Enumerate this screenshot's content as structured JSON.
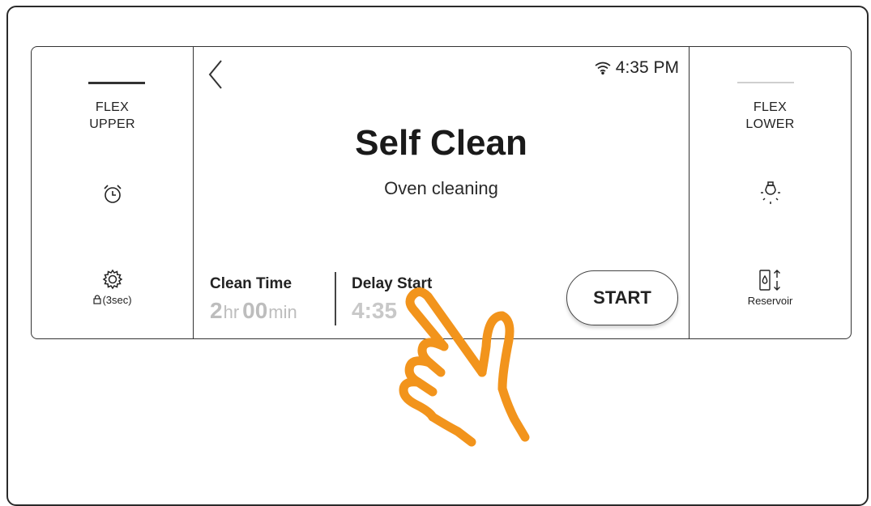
{
  "left_panel": {
    "mode_line1": "FLEX",
    "mode_line2": "UPPER",
    "timer_icon": "alarm-clock-icon",
    "settings_icon": "gear-icon",
    "lock_label": "(3sec)"
  },
  "right_panel": {
    "mode_line1": "FLEX",
    "mode_line2": "LOWER",
    "light_icon": "light-bulb-icon",
    "reservoir_label": "Reservoir"
  },
  "header": {
    "back_icon": "chevron-left-icon",
    "wifi_icon": "wifi-icon",
    "time": "4:35 PM"
  },
  "main": {
    "title": "Self Clean",
    "subtitle": "Oven cleaning"
  },
  "clean_time": {
    "label": "Clean Time",
    "hours": "2",
    "hours_unit": "hr",
    "minutes": "00",
    "minutes_unit": "min"
  },
  "delay_start": {
    "label": "Delay Start",
    "value": "4:35"
  },
  "start_button": {
    "label": "START"
  },
  "colors": {
    "hand_accent": "#f2941c",
    "inactive_value": "#bdbdbd"
  }
}
